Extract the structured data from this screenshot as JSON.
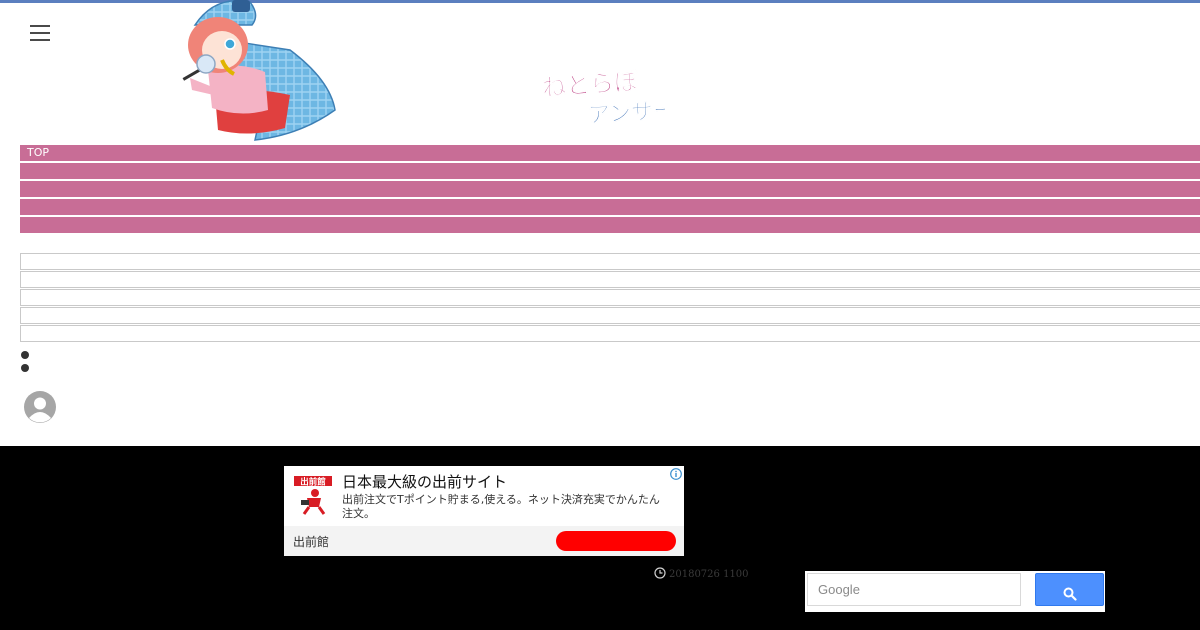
{
  "header": {
    "logo_line1": "ねとらぼ",
    "logo_line2": "アンサー",
    "menu_icon": "hamburger-menu-icon",
    "mascot": "detective-girl-mascot",
    "colors": {
      "top_border": "#5b7fbf",
      "logo_line1": "#b8327a",
      "logo_line2": "#3b6fb5"
    }
  },
  "nav": {
    "color": "#c86d96",
    "items": [
      {
        "label": "TOP"
      },
      {
        "label": ""
      },
      {
        "label": ""
      },
      {
        "label": ""
      },
      {
        "label": ""
      }
    ]
  },
  "list_rows": 5,
  "ad": {
    "brand_mark": "出前館",
    "title": "日本最大級の出前サイト",
    "description": "出前注文でTポイント貯まる,使える。ネット決済充実でかんたん注文。",
    "advertiser": "出前館",
    "info_icon": "info-icon",
    "cta_color": "#ff0000"
  },
  "footer": {
    "date": "20180726 1100",
    "date_icon": "clock-icon",
    "search": {
      "placeholder": "Google",
      "button_icon": "search-icon",
      "button_color": "#4d90fe"
    }
  }
}
